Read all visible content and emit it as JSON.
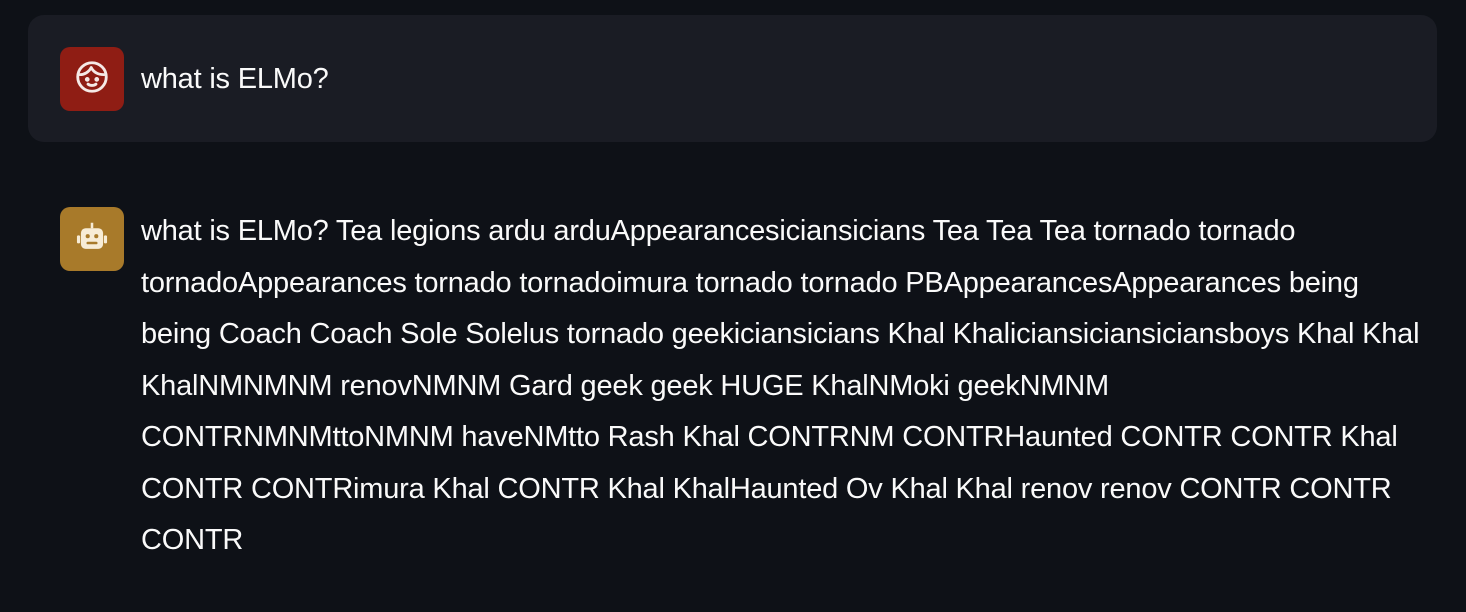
{
  "messages": {
    "user": {
      "role": "user",
      "avatar_icon": "user-face-icon",
      "avatar_color": "#8f1d14",
      "text": "what is ELMo?"
    },
    "assistant": {
      "role": "assistant",
      "avatar_icon": "robot-icon",
      "avatar_color": "#a87a2a",
      "text": "what is ELMo? Tea legions ardu arduAppearancesiciansicians Tea Tea Tea tornado tornado tornadoAppearances tornado tornadoimura tornado tornado PBAppearancesAppearances being being Coach Coach Sole Solelus tornado geekiciansicians Khal Khaliciansiciansiciansboys Khal Khal KhalNMNMNM renovNMNM Gard geek geek HUGE KhalNMoki geekNMNM CONTRNMNMttoNMNM haveNMtto Rash Khal CONTRNM CONTRHaunted CONTR CONTR Khal CONTR CONTRimura Khal CONTR Khal KhalHaunted Ov Khal Khal renov renov CONTR CONTR CONTR"
    }
  },
  "colors": {
    "background": "#0e1117",
    "user_bubble": "#1a1c24",
    "text": "#fafafa"
  }
}
